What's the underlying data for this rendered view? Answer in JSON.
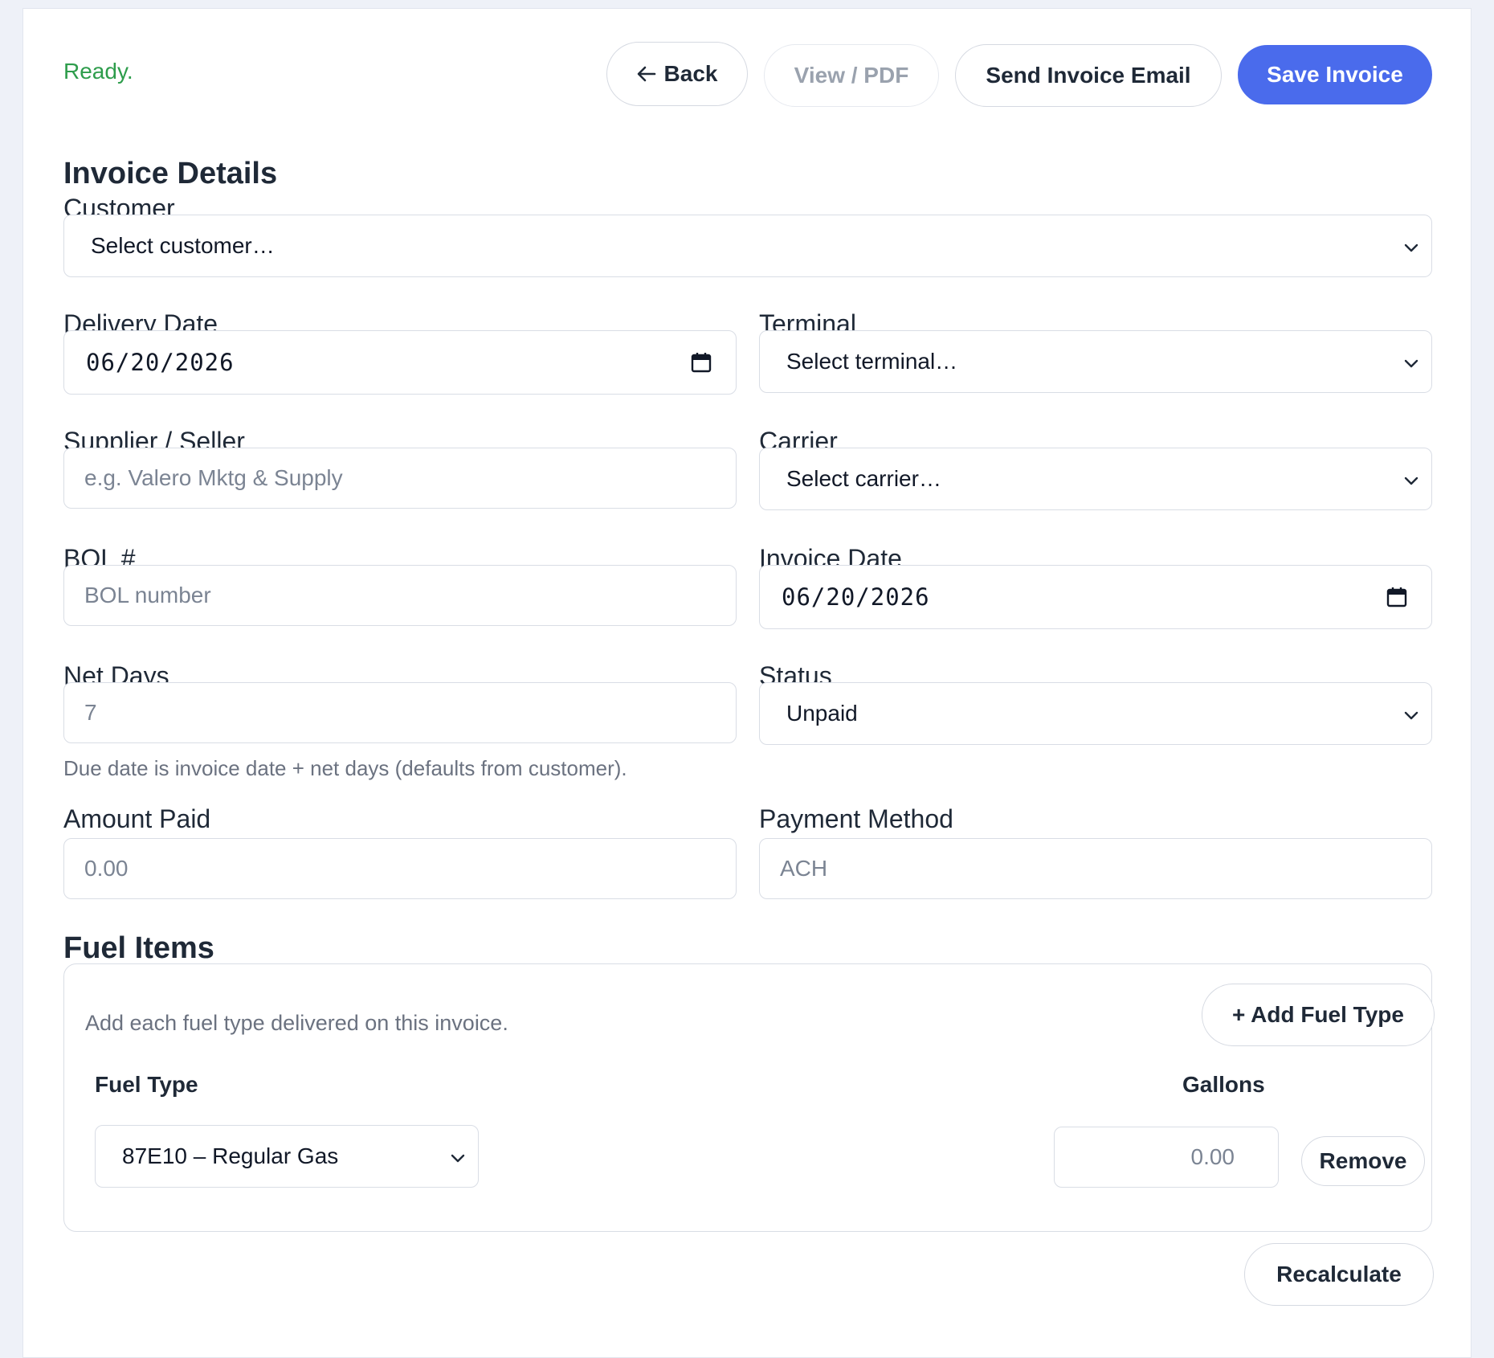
{
  "toolbar": {
    "status": "Ready.",
    "back_label": "Back",
    "view_pdf_label": "View / PDF",
    "send_email_label": "Send Invoice Email",
    "save_label": "Save Invoice"
  },
  "invoice_details": {
    "title": "Invoice Details",
    "customer": {
      "label": "Customer",
      "value": "Select customer…"
    },
    "delivery_date": {
      "label": "Delivery Date",
      "value": "06/20/2026"
    },
    "terminal": {
      "label": "Terminal",
      "value": "Select terminal…"
    },
    "supplier": {
      "label": "Supplier / Seller",
      "placeholder": "e.g. Valero Mktg & Supply"
    },
    "carrier": {
      "label": "Carrier",
      "value": "Select carrier…"
    },
    "bol": {
      "label": "BOL #",
      "placeholder": "BOL number"
    },
    "invoice_date": {
      "label": "Invoice Date",
      "value": "06/20/2026"
    },
    "net_days": {
      "label": "Net Days",
      "value": "7"
    },
    "status": {
      "label": "Status",
      "value": "Unpaid"
    },
    "net_days_help": "Due date is invoice date + net days (defaults from customer).",
    "amount_paid": {
      "label": "Amount Paid",
      "placeholder": "0.00"
    },
    "payment_method": {
      "label": "Payment Method",
      "placeholder": "ACH"
    }
  },
  "fuel_items": {
    "title": "Fuel Items",
    "hint": "Add each fuel type delivered on this invoice.",
    "add_label": "+ Add Fuel Type",
    "col_fuel_type": "Fuel Type",
    "col_gallons": "Gallons",
    "rows": [
      {
        "fuel_type": "87E10 – Regular Gas",
        "gallons_placeholder": "0.00",
        "remove_label": "Remove"
      }
    ]
  },
  "recalculate_label": "Recalculate",
  "colors": {
    "accent": "#4a6bec",
    "status_ready": "#2e9d4c"
  }
}
